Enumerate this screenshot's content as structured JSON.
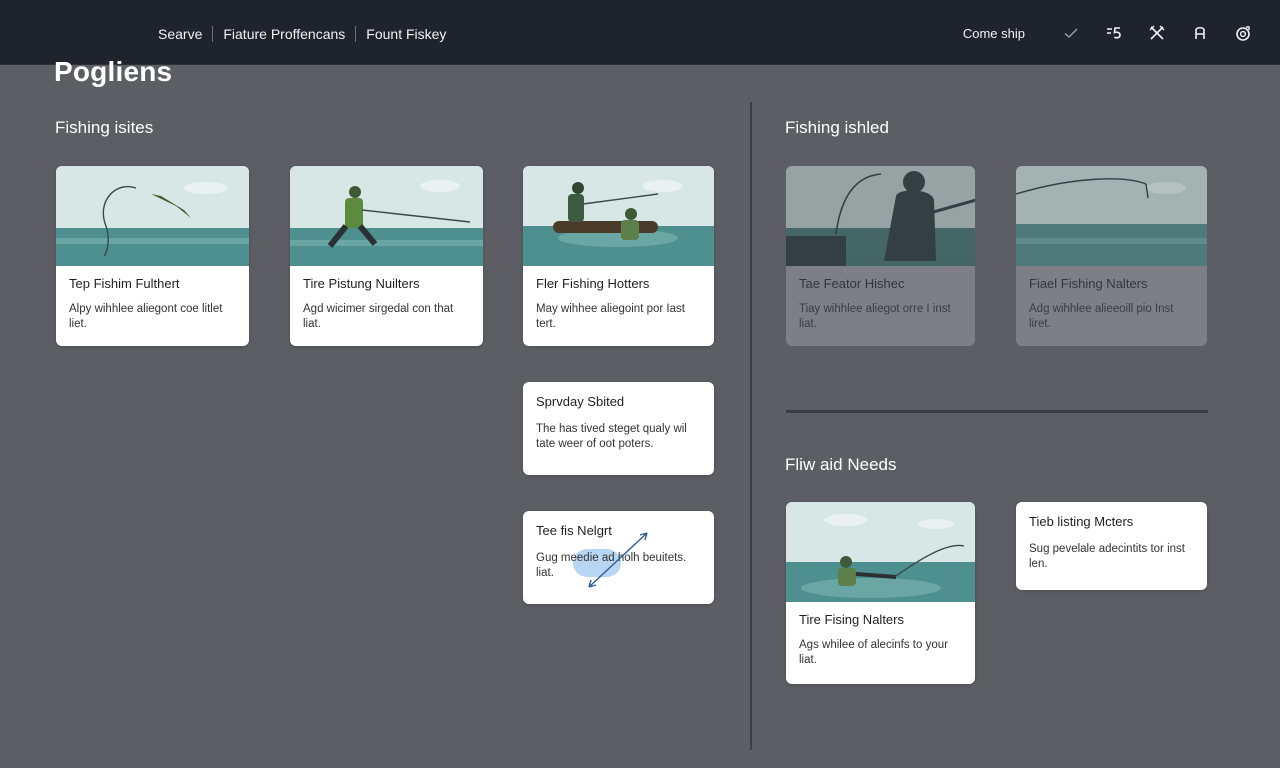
{
  "header": {
    "nav": [
      "Searve",
      "Fiature Proffencans",
      "Fount Fiskey"
    ],
    "right_label": "Come ship",
    "tools": [
      "check-icon",
      "sort-icon",
      "crossed-tools-icon",
      "text-a-icon",
      "camera-icon"
    ]
  },
  "page": {
    "title": "Pogliens"
  },
  "sections": {
    "left": {
      "title": "Fishing isites"
    },
    "right_top": {
      "title": "Fishing ishled"
    },
    "right_bottom": {
      "title": "Fliw aid Needs"
    }
  },
  "cards": {
    "c1": {
      "title": "Tep Fishim Fulthert",
      "desc": "Alpy wihhlee aliegont coe litlet liet."
    },
    "c2": {
      "title": "Tire Pistung Nuilters",
      "desc": "Agd wicimer sirgedal con that liat."
    },
    "c3": {
      "title": "Fler Fishing Hotters",
      "desc": "May wihhee aliegoint por Iast tert."
    },
    "c4": {
      "title": "Sprvday Sbited",
      "desc": "The has tived steget qualy wil tate weer of oot poters."
    },
    "c5": {
      "title": "Tee fis Nelgrt",
      "desc": "Gug meedie ad holh beuitets. liat."
    },
    "c6": {
      "title": "Tae Feator Hishec",
      "desc": "Tiay wihhlee aliegot orre I inst liat."
    },
    "c7": {
      "title": "Fiael Fishing Nalters",
      "desc": "Adg wihhlee alieeoill pio Inst liret."
    },
    "c8": {
      "title": "Tire Fising Nalters",
      "desc": "Ags whilee of alecinfs to your liat."
    },
    "c9": {
      "title": "Tieb listing Mcters",
      "desc": "Sug pevelale adecintits tor inst len."
    }
  },
  "colors": {
    "topbar": "#1f232d",
    "background": "#5c5e64",
    "card": "#ffffff",
    "card_dim": "#7d7f84",
    "sky": "#d7e7e5",
    "water": "#4e8f8f",
    "highlight": "#b7d6f3",
    "arrow": "#2f5f92"
  }
}
